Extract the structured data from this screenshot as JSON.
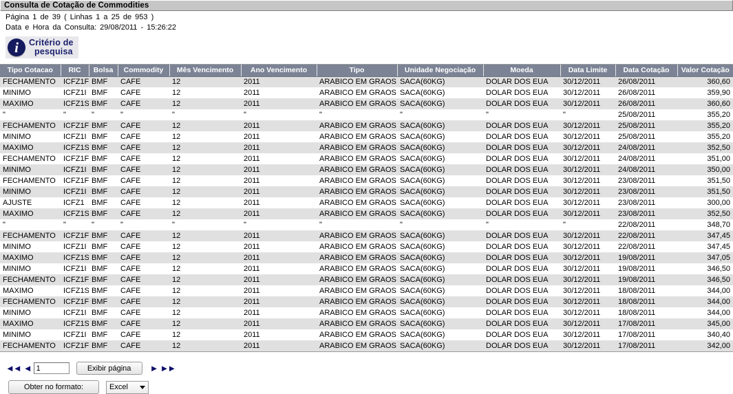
{
  "window": {
    "title": "Consulta de Cotação de Commodities"
  },
  "info": {
    "pagination_text": "Página  1  de  39   (  Linhas  1  a  25  de  953  )",
    "datetime_text": "Data e Hora da Consulta: 29/08/2011 - 15:26:22"
  },
  "criterio": {
    "icon": "info-icon",
    "line1": "Critério de",
    "line2": "pesquisa"
  },
  "table": {
    "columns": [
      "Tipo Cotacao",
      "RIC",
      "Bolsa",
      "Commodity",
      "Mês Vencimento",
      "Ano Vencimento",
      "Tipo",
      "Unidade Negociação",
      "Moeda",
      "Data Limite",
      "Data Cotação",
      "Valor Cotação"
    ],
    "rows": [
      [
        "FECHAMENTO",
        "ICFZ1F",
        "BMF",
        "CAFE",
        "12",
        "2011",
        "ARABICO EM GRAOS",
        "SACA(60KG)",
        "DOLAR DOS EUA",
        "30/12/2011",
        "26/08/2011",
        "360,60"
      ],
      [
        "MINIMO",
        "ICFZ1I",
        "BMF",
        "CAFE",
        "12",
        "2011",
        "ARABICO EM GRAOS",
        "SACA(60KG)",
        "DOLAR DOS EUA",
        "30/12/2011",
        "26/08/2011",
        "359,90"
      ],
      [
        "MAXIMO",
        "ICFZ1S",
        "BMF",
        "CAFE",
        "12",
        "2011",
        "ARABICO EM GRAOS",
        "SACA(60KG)",
        "DOLAR DOS EUA",
        "30/12/2011",
        "26/08/2011",
        "360,60"
      ],
      [
        "\"",
        "\"",
        "\"",
        "\"",
        "\"",
        "\"",
        "\"",
        "\"",
        "\"",
        "\"",
        "25/08/2011",
        "355,20"
      ],
      [
        "FECHAMENTO",
        "ICFZ1F",
        "BMF",
        "CAFE",
        "12",
        "2011",
        "ARABICO EM GRAOS",
        "SACA(60KG)",
        "DOLAR DOS EUA",
        "30/12/2011",
        "25/08/2011",
        "355,20"
      ],
      [
        "MINIMO",
        "ICFZ1I",
        "BMF",
        "CAFE",
        "12",
        "2011",
        "ARABICO EM GRAOS",
        "SACA(60KG)",
        "DOLAR DOS EUA",
        "30/12/2011",
        "25/08/2011",
        "355,20"
      ],
      [
        "MAXIMO",
        "ICFZ1S",
        "BMF",
        "CAFE",
        "12",
        "2011",
        "ARABICO EM GRAOS",
        "SACA(60KG)",
        "DOLAR DOS EUA",
        "30/12/2011",
        "24/08/2011",
        "352,50"
      ],
      [
        "FECHAMENTO",
        "ICFZ1F",
        "BMF",
        "CAFE",
        "12",
        "2011",
        "ARABICO EM GRAOS",
        "SACA(60KG)",
        "DOLAR DOS EUA",
        "30/12/2011",
        "24/08/2011",
        "351,00"
      ],
      [
        "MINIMO",
        "ICFZ1I",
        "BMF",
        "CAFE",
        "12",
        "2011",
        "ARABICO EM GRAOS",
        "SACA(60KG)",
        "DOLAR DOS EUA",
        "30/12/2011",
        "24/08/2011",
        "350,00"
      ],
      [
        "FECHAMENTO",
        "ICFZ1F",
        "BMF",
        "CAFE",
        "12",
        "2011",
        "ARABICO EM GRAOS",
        "SACA(60KG)",
        "DOLAR DOS EUA",
        "30/12/2011",
        "23/08/2011",
        "351,50"
      ],
      [
        "MINIMO",
        "ICFZ1I",
        "BMF",
        "CAFE",
        "12",
        "2011",
        "ARABICO EM GRAOS",
        "SACA(60KG)",
        "DOLAR DOS EUA",
        "30/12/2011",
        "23/08/2011",
        "351,50"
      ],
      [
        "AJUSTE",
        "ICFZ1",
        "BMF",
        "CAFE",
        "12",
        "2011",
        "ARABICO EM GRAOS",
        "SACA(60KG)",
        "DOLAR DOS EUA",
        "30/12/2011",
        "23/08/2011",
        "300,00"
      ],
      [
        "MAXIMO",
        "ICFZ1S",
        "BMF",
        "CAFE",
        "12",
        "2011",
        "ARABICO EM GRAOS",
        "SACA(60KG)",
        "DOLAR DOS EUA",
        "30/12/2011",
        "23/08/2011",
        "352,50"
      ],
      [
        "\"",
        "\"",
        "\"",
        "\"",
        "\"",
        "\"",
        "\"",
        "\"",
        "\"",
        "\"",
        "22/08/2011",
        "348,70"
      ],
      [
        "FECHAMENTO",
        "ICFZ1F",
        "BMF",
        "CAFE",
        "12",
        "2011",
        "ARABICO EM GRAOS",
        "SACA(60KG)",
        "DOLAR DOS EUA",
        "30/12/2011",
        "22/08/2011",
        "347,45"
      ],
      [
        "MINIMO",
        "ICFZ1I",
        "BMF",
        "CAFE",
        "12",
        "2011",
        "ARABICO EM GRAOS",
        "SACA(60KG)",
        "DOLAR DOS EUA",
        "30/12/2011",
        "22/08/2011",
        "347,45"
      ],
      [
        "MAXIMO",
        "ICFZ1S",
        "BMF",
        "CAFE",
        "12",
        "2011",
        "ARABICO EM GRAOS",
        "SACA(60KG)",
        "DOLAR DOS EUA",
        "30/12/2011",
        "19/08/2011",
        "347,05"
      ],
      [
        "MINIMO",
        "ICFZ1I",
        "BMF",
        "CAFE",
        "12",
        "2011",
        "ARABICO EM GRAOS",
        "SACA(60KG)",
        "DOLAR DOS EUA",
        "30/12/2011",
        "19/08/2011",
        "346,50"
      ],
      [
        "FECHAMENTO",
        "ICFZ1F",
        "BMF",
        "CAFE",
        "12",
        "2011",
        "ARABICO EM GRAOS",
        "SACA(60KG)",
        "DOLAR DOS EUA",
        "30/12/2011",
        "19/08/2011",
        "346,50"
      ],
      [
        "MAXIMO",
        "ICFZ1S",
        "BMF",
        "CAFE",
        "12",
        "2011",
        "ARABICO EM GRAOS",
        "SACA(60KG)",
        "DOLAR DOS EUA",
        "30/12/2011",
        "18/08/2011",
        "344,00"
      ],
      [
        "FECHAMENTO",
        "ICFZ1F",
        "BMF",
        "CAFE",
        "12",
        "2011",
        "ARABICO EM GRAOS",
        "SACA(60KG)",
        "DOLAR DOS EUA",
        "30/12/2011",
        "18/08/2011",
        "344,00"
      ],
      [
        "MINIMO",
        "ICFZ1I",
        "BMF",
        "CAFE",
        "12",
        "2011",
        "ARABICO EM GRAOS",
        "SACA(60KG)",
        "DOLAR DOS EUA",
        "30/12/2011",
        "18/08/2011",
        "344,00"
      ],
      [
        "MAXIMO",
        "ICFZ1S",
        "BMF",
        "CAFE",
        "12",
        "2011",
        "ARABICO EM GRAOS",
        "SACA(60KG)",
        "DOLAR DOS EUA",
        "30/12/2011",
        "17/08/2011",
        "345,00"
      ],
      [
        "MINIMO",
        "ICFZ1I",
        "BMF",
        "CAFE",
        "12",
        "2011",
        "ARABICO EM GRAOS",
        "SACA(60KG)",
        "DOLAR DOS EUA",
        "30/12/2011",
        "17/08/2011",
        "340,40"
      ],
      [
        "FECHAMENTO",
        "ICFZ1F",
        "BMF",
        "CAFE",
        "12",
        "2011",
        "ARABICO EM GRAOS",
        "SACA(60KG)",
        "DOLAR DOS EUA",
        "30/12/2011",
        "17/08/2011",
        "342,00"
      ]
    ]
  },
  "pager": {
    "first_icon": "double-left-arrow-icon",
    "prev_icon": "left-arrow-icon",
    "next_icon": "right-arrow-icon",
    "last_icon": "double-right-arrow-icon",
    "page_value": "1",
    "show_page_label": "Exibir página"
  },
  "export": {
    "button_label": "Obter no formato:",
    "format_value": "Excel",
    "format_options": [
      "Excel"
    ]
  },
  "colors": {
    "header_bg": "#7b8395",
    "row_alt_bg": "#e0e0e0",
    "value_text": "#2a2ab0",
    "accent": "#1a1f6b"
  }
}
